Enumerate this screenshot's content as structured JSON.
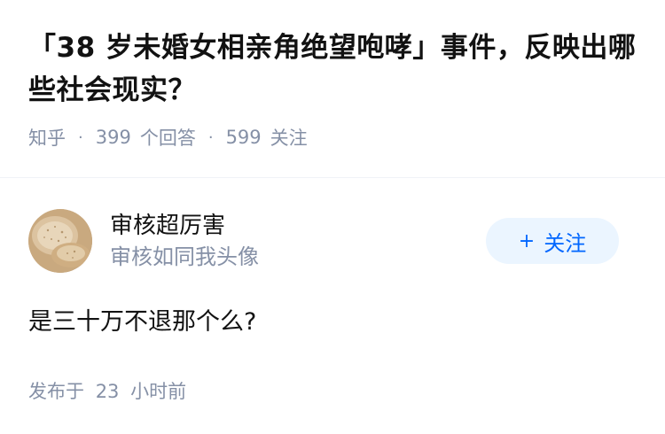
{
  "question": {
    "title": "「38 岁未婚女相亲角绝望咆哮」事件，反映出哪些社会现实？",
    "source": "知乎",
    "answer_count": "399",
    "answer_label": "个回答",
    "follower_count": "599",
    "follower_label": "关注"
  },
  "answer": {
    "author_name": "审核超厉害",
    "author_bio": "审核如同我头像",
    "follow_plus": "+",
    "follow_label": "关注",
    "content": "是三十万不退那个么?",
    "time_prefix": "发布于",
    "time_value": "23",
    "time_suffix": "小时前"
  },
  "colors": {
    "title": "#121212",
    "meta": "#8590a6",
    "follow_bg": "#ebf5ff",
    "follow_text": "#0066ff"
  },
  "icons": {
    "avatar": "flatbread-photo"
  }
}
